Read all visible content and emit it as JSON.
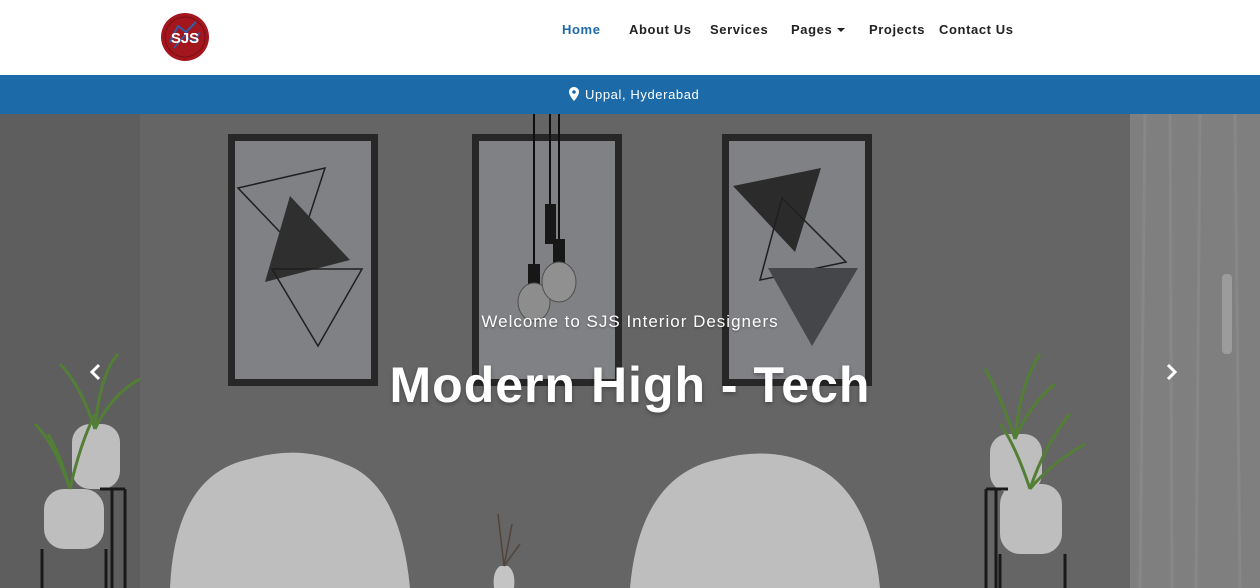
{
  "brand": {
    "logo_text": "SJS"
  },
  "nav": {
    "items": [
      {
        "label": "Home"
      },
      {
        "label": "About Us"
      },
      {
        "label": "Services"
      },
      {
        "label": "Pages"
      },
      {
        "label": "Projects"
      },
      {
        "label": "Contact Us"
      }
    ]
  },
  "location": {
    "text": "Uppal, Hyderabad",
    "icon": "map-marker-icon"
  },
  "hero": {
    "subtitle": "Welcome to SJS Interior Designers",
    "title": "Modern High - Tech",
    "prev_icon": "chevron-left-icon",
    "next_icon": "chevron-right-icon"
  },
  "colors": {
    "accent": "#1c6aa8",
    "logo_red": "#a3161d",
    "nav_text": "#222222",
    "hero_text": "#ffffff"
  }
}
